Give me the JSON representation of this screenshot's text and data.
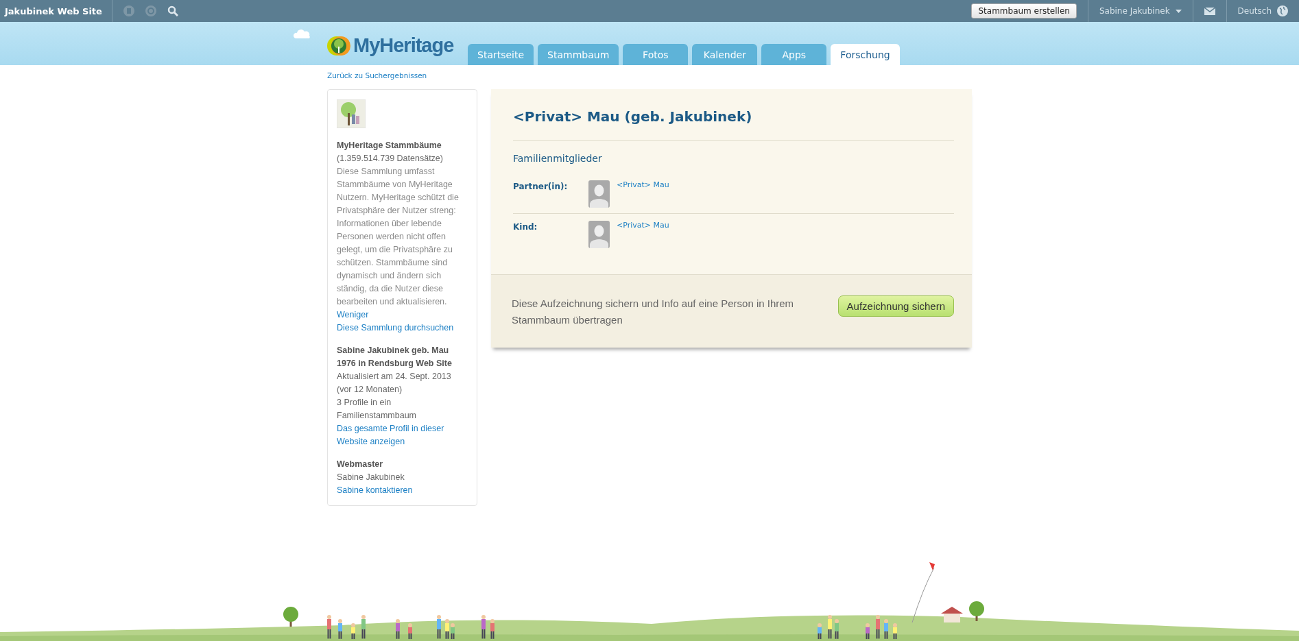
{
  "top_bar": {
    "site_name": "Jakubinek Web Site",
    "create_button": "Stammbaum erstellen",
    "user": "Sabine Jakubinek",
    "language": "Deutsch"
  },
  "logo": "MyHeritage",
  "tabs": [
    {
      "label": "Startseite",
      "selected": false
    },
    {
      "label": "Stammbaum",
      "selected": false
    },
    {
      "label": "Fotos",
      "selected": false
    },
    {
      "label": "Kalender",
      "selected": false
    },
    {
      "label": "Apps",
      "selected": false
    },
    {
      "label": "Forschung",
      "selected": true
    }
  ],
  "back_link": "Zurück zu Suchergebnissen",
  "sidebar": {
    "collection_title": "MyHeritage Stammbäume",
    "record_count": "(1.359.514.739 Datensätze)",
    "description": "Diese Sammlung umfasst Stammbäume von MyHeritage Nutzern. MyHeritage schützt die Privatsphäre der Nutzer streng: Informationen über lebende Personen werden nicht offen gelegt, um die Privatsphäre zu schützen. Stammbäume sind dynamisch und ändern sich ständig, da die Nutzer diese bearbeiten und aktualisieren.",
    "less_link": "Weniger",
    "search_link": "Diese Sammlung durchsuchen",
    "site_title": "Sabine Jakubinek geb. Mau 1976 in Rendsburg Web Site",
    "updated": "Aktualisiert am 24. Sept. 2013",
    "age": "(vor 12 Monaten)",
    "profiles": "3 Profile in ein Familienstammbaum",
    "profile_link": "Das gesamte Profil in dieser Website anzeigen",
    "webmaster_heading": "Webmaster",
    "webmaster_name": "Sabine Jakubinek",
    "contact_link": "Sabine kontaktieren"
  },
  "record": {
    "title": "<Privat> Mau (geb. Jakubinek)",
    "section_heading": "Familienmitglieder",
    "members": [
      {
        "relation": "Partner(in):",
        "name": "<Privat> Mau"
      },
      {
        "relation": "Kind:",
        "name": "<Privat> Mau"
      }
    ],
    "save_prompt": "Diese Aufzeichnung sichern und Info auf eine Person in Ihrem Stammbaum übertragen",
    "save_button": "Aufzeichnung sichern"
  }
}
